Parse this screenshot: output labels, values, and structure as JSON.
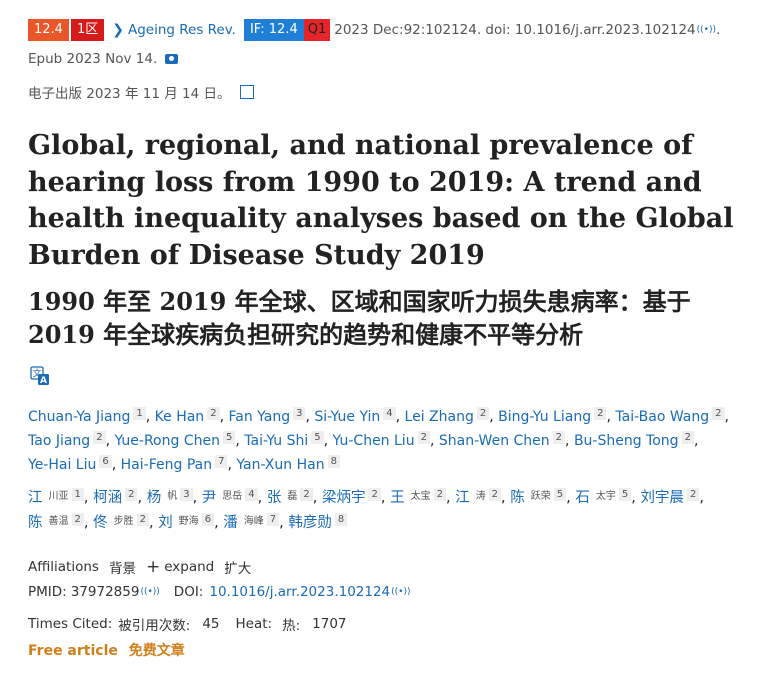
{
  "citation": {
    "score_badge": "12.4",
    "zone_badge": "1区",
    "journal": "Ageing Res Rev.",
    "if_badge": "IF: 12.4",
    "quartile_badge": "Q1",
    "ref_text": "2023 Dec:92:102124. doi: 10.1016/j.arr.2023.102124",
    "ref_end": ".",
    "epub": "Epub 2023 Nov 14.",
    "epub_zh": "电子出版 2023 年 11 月 14 日。"
  },
  "title_en": "Global, regional, and national prevalence of hearing loss from 1990 to 2019: A trend and health inequality analyses based on the Global Burden of Disease Study 2019",
  "title_zh": "1990 年至 2019 年全球、区域和国家听力损失患病率：基于 2019 年全球疾病负担研究的趋势和健康不平等分析",
  "authors": [
    {
      "name": "Chuan-Ya Jiang",
      "aff": "1"
    },
    {
      "name": "Ke Han",
      "aff": "2"
    },
    {
      "name": "Fan Yang",
      "aff": "3"
    },
    {
      "name": "Si-Yue Yin",
      "aff": "4"
    },
    {
      "name": "Lei Zhang",
      "aff": "2"
    },
    {
      "name": "Bing-Yu Liang",
      "aff": "2"
    },
    {
      "name": "Tai-Bao Wang",
      "aff": "2"
    },
    {
      "name": "Tao Jiang",
      "aff": "2"
    },
    {
      "name": "Yue-Rong Chen",
      "aff": "5"
    },
    {
      "name": "Tai-Yu Shi",
      "aff": "5"
    },
    {
      "name": "Yu-Chen Liu",
      "aff": "2"
    },
    {
      "name": "Shan-Wen Chen",
      "aff": "2"
    },
    {
      "name": "Bu-Sheng Tong",
      "aff": "2"
    },
    {
      "name": "Ye-Hai Liu",
      "aff": "6"
    },
    {
      "name": "Hai-Feng Pan",
      "aff": "7"
    },
    {
      "name": "Yan-Xun Han",
      "aff": "8"
    }
  ],
  "authors_zh": [
    {
      "sur": "江",
      "giv": "川亚",
      "aff": "1"
    },
    {
      "sur": "柯涵",
      "giv": "",
      "aff": "2"
    },
    {
      "sur": "杨",
      "giv": "帆",
      "aff": "3"
    },
    {
      "sur": "尹",
      "giv": "思岳",
      "aff": "4"
    },
    {
      "sur": "张",
      "giv": "磊",
      "aff": "2"
    },
    {
      "sur": "梁炳宇",
      "giv": "",
      "aff": "2"
    },
    {
      "sur": "王",
      "giv": "太宝",
      "aff": "2"
    },
    {
      "sur": "江",
      "giv": "涛",
      "aff": "2"
    },
    {
      "sur": "陈",
      "giv": "跃荣",
      "aff": "5"
    },
    {
      "sur": "石",
      "giv": "太宇",
      "aff": "5"
    },
    {
      "sur": "刘宇晨",
      "giv": "",
      "aff": "2"
    },
    {
      "sur": "陈",
      "giv": "善温",
      "aff": "2"
    },
    {
      "sur": "佟",
      "giv": "步胜",
      "aff": "2"
    },
    {
      "sur": "刘",
      "giv": "野海",
      "aff": "6"
    },
    {
      "sur": "潘",
      "giv": "海峰",
      "aff": "7"
    },
    {
      "sur": "韩彦勋",
      "giv": "",
      "aff": "8"
    }
  ],
  "affiliations": {
    "label": "Affiliations",
    "label_zh": "背景",
    "plus": "+",
    "expand": "expand",
    "expand_zh": "扩大"
  },
  "ids": {
    "pmid_label": "PMID:",
    "pmid": "37972859",
    "doi_label": "DOI:",
    "doi": "10.1016/j.arr.2023.102124"
  },
  "cited": {
    "label": "Times Cited:",
    "label_zh": "被引用次数:",
    "count": "45",
    "heat_label": "Heat:",
    "heat_zh": "热:",
    "heat": "1707"
  },
  "free": {
    "label": "Free article",
    "label_zh": "免费文章"
  },
  "colors": {
    "link": "#1a6bb8",
    "score_badge": "#e8562a",
    "zone_badge": "#d71a1a",
    "if_badge": "#1f7fd6",
    "q_badge": "#e5252a",
    "free": "#d07f1a"
  },
  "icons": {
    "translate": "translate-icon",
    "podcast": "broadcast-icon",
    "camera": "camera-icon",
    "checkbox": "checkbox-icon"
  }
}
